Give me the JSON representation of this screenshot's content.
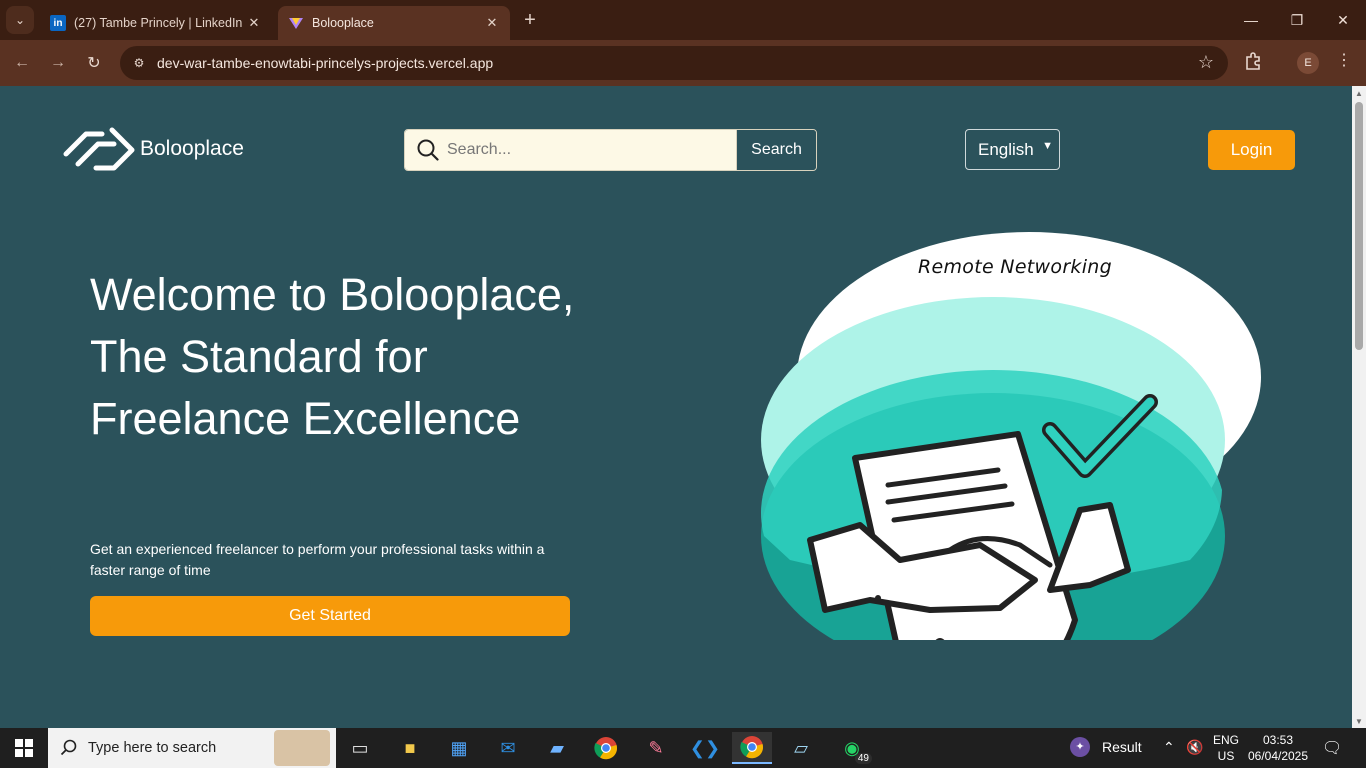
{
  "browser": {
    "tabs": [
      {
        "title": "(27) Tambe Princely | LinkedIn",
        "favicon": "in",
        "active": false
      },
      {
        "title": "Bolooplace",
        "active": true
      }
    ],
    "url": "dev-war-tambe-enowtabi-princelys-projects.vercel.app",
    "profile_initial": "E"
  },
  "header": {
    "brand": "Bolooplace",
    "search_placeholder": "Search...",
    "search_button": "Search",
    "language": "English",
    "login": "Login"
  },
  "hero": {
    "title": "Welcome to Bolooplace, The Standard for Freelance Excellence",
    "subtitle": "Get an experienced freelancer to perform your professional tasks within a faster range of time",
    "cta": "Get Started",
    "illustration_caption": "Remote Networking"
  },
  "taskbar": {
    "search_label": "Type here to search",
    "whatsapp_badge": "49",
    "tray_app": "Result",
    "lang_line1": "ENG",
    "lang_line2": "US",
    "time": "03:53",
    "date": "06/04/2025"
  },
  "colors": {
    "page_bg": "#2b525b",
    "accent": "#f79a0a",
    "search_bg": "#fdf9e6",
    "teal_light": "#aef3e8",
    "teal_mid": "#2fd1bf",
    "teal_dark": "#18a395"
  }
}
